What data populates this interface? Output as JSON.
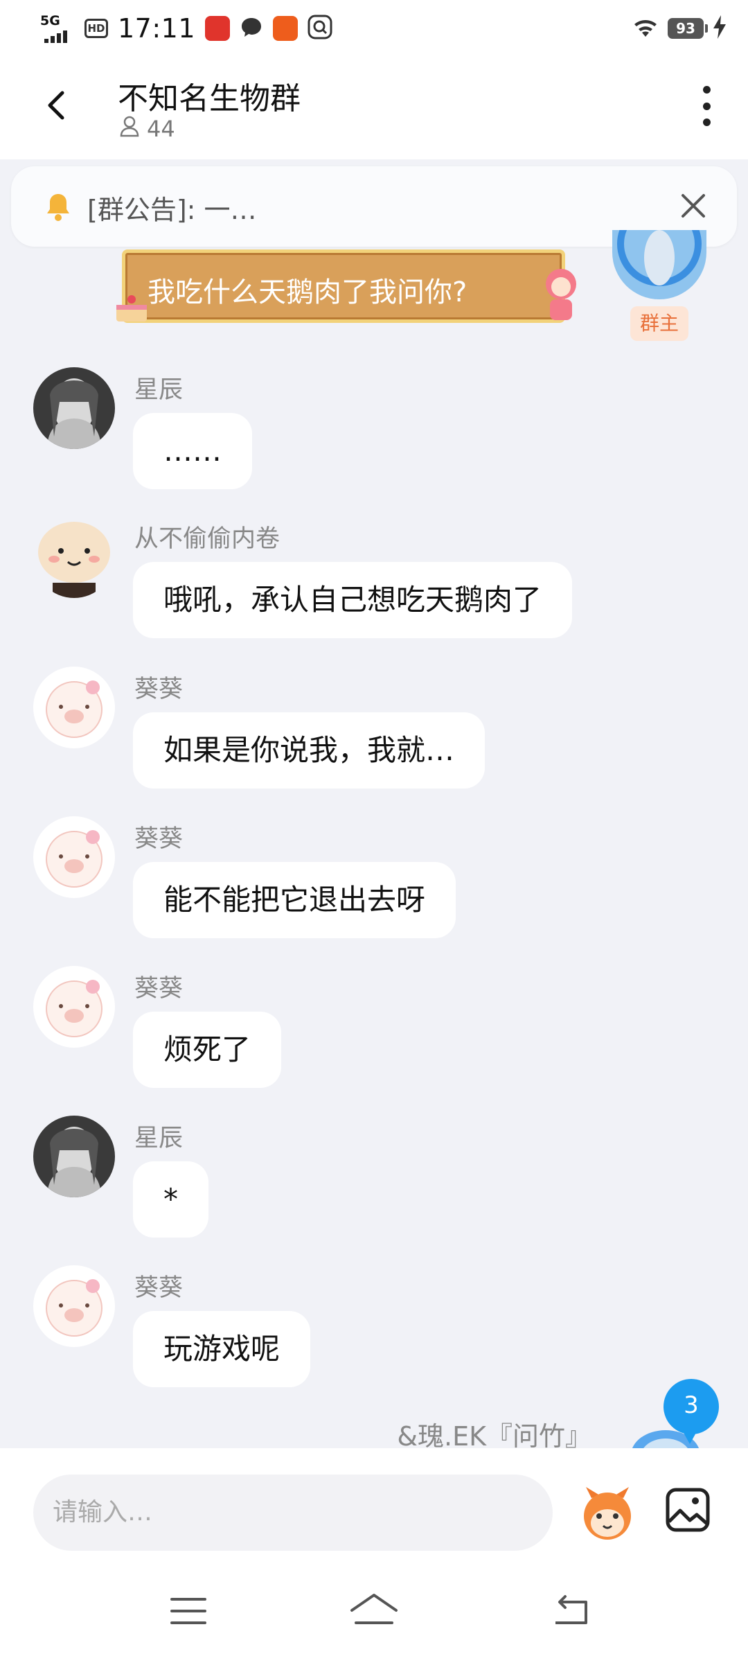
{
  "status_bar": {
    "network": "5G",
    "hd": "HD",
    "time": "17:11",
    "battery": "93"
  },
  "header": {
    "title": "不知名生物群",
    "member_count": "44"
  },
  "notice": {
    "text": "[群公告]: 一…"
  },
  "owner_message": {
    "text": "我吃什么天鹅肉了我问你?",
    "badge": "群主"
  },
  "messages": [
    {
      "sender": "星辰",
      "text": "……",
      "avatar": "anime-girl-avatar"
    },
    {
      "sender": "从不偷偷内卷",
      "text": "哦吼，承认自己想吃天鹅肉了",
      "avatar": "bun-avatar"
    },
    {
      "sender": "葵葵",
      "text": "如果是你说我，我就…",
      "avatar": "pig-avatar"
    },
    {
      "sender": "葵葵",
      "text": "能不能把它退出去呀",
      "avatar": "pig-avatar"
    },
    {
      "sender": "葵葵",
      "text": "烦死了",
      "avatar": "pig-avatar"
    },
    {
      "sender": "星辰",
      "text": "*",
      "avatar": "anime-girl-avatar"
    },
    {
      "sender": "葵葵",
      "text": "玩游戏呢",
      "avatar": "pig-avatar"
    }
  ],
  "partial_message": {
    "sender": "&瑰.EK『问竹』"
  },
  "unread_badge": "3",
  "input": {
    "placeholder": "请输入…"
  },
  "colors": {
    "background": "#f1f2f7",
    "accent": "#1c9cf0",
    "owner_bubble": "#d9a05a",
    "owner_badge_text": "#e8703a"
  }
}
